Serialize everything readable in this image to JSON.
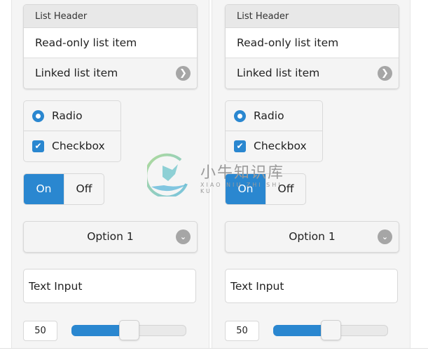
{
  "panels": [
    {
      "list": {
        "header": "List Header",
        "read_only_item": "Read-only list item",
        "linked_item": "Linked list item",
        "linked_icon": "chevron-right-icon"
      },
      "radio_label": "Radio",
      "radio_checked": true,
      "checkbox_label": "Checkbox",
      "checkbox_checked": true,
      "toggle": {
        "on_label": "On",
        "off_label": "Off",
        "selected": "On"
      },
      "select": {
        "value": "Option 1",
        "icon": "chevron-down-icon"
      },
      "text_input": {
        "value": "Text Input"
      },
      "slider": {
        "value": "50",
        "min": 0,
        "max": 100
      }
    },
    {
      "list": {
        "header": "List Header",
        "read_only_item": "Read-only list item",
        "linked_item": "Linked list item",
        "linked_icon": "chevron-right-icon"
      },
      "radio_label": "Radio",
      "radio_checked": true,
      "checkbox_label": "Checkbox",
      "checkbox_checked": true,
      "toggle": {
        "on_label": "On",
        "off_label": "Off",
        "selected": "On"
      },
      "select": {
        "value": "Option 1",
        "icon": "chevron-down-icon"
      },
      "text_input": {
        "value": "Text Input"
      },
      "slider": {
        "value": "50",
        "min": 0,
        "max": 100
      }
    }
  ],
  "watermark": {
    "chinese": "小牛知识库",
    "latin": "XIAO NIU ZHI SHI KU"
  },
  "colors": {
    "accent": "#2a87d0",
    "icon_gray": "#a6a6a6",
    "panel_bg": "#f5f5f5"
  },
  "glyphs": {
    "chevron_right": "❯",
    "chevron_down": "⌄",
    "check": "✔"
  }
}
